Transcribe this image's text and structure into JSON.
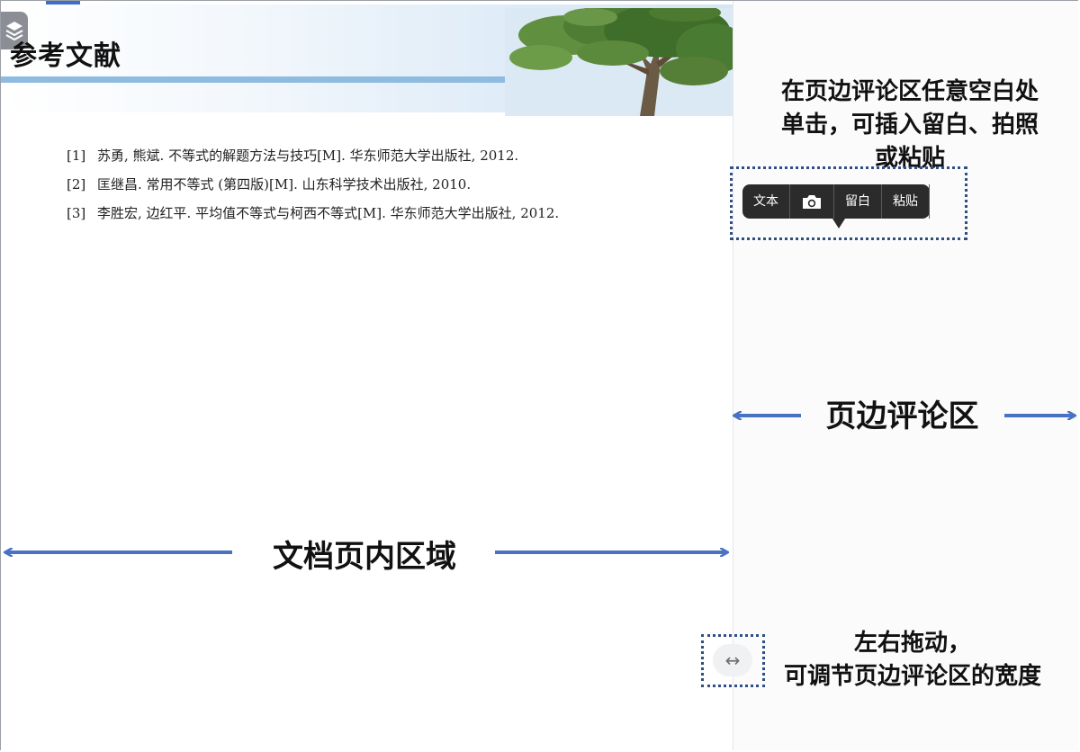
{
  "doc": {
    "title": "参考文献",
    "references": [
      {
        "num": "[1]",
        "text": "苏勇, 熊斌. 不等式的解题方法与技巧[M]. 华东师范大学出版社, 2012."
      },
      {
        "num": "[2]",
        "text": "匡继昌. 常用不等式 (第四版)[M]. 山东科学技术出版社, 2010."
      },
      {
        "num": "[3]",
        "text": "李胜宏, 边红平. 平均值不等式与柯西不等式[M]. 华东师范大学出版社, 2012."
      }
    ]
  },
  "toolbar": {
    "text_label": "文本",
    "camera_icon": "camera-icon",
    "blank_label": "留白",
    "paste_label": "粘贴"
  },
  "annotations": {
    "tip_line1": "在页边评论区任意空白处",
    "tip_line2": "单击，可插入留白、拍照",
    "tip_line3": "或粘贴",
    "margin_area": "页边评论区",
    "doc_area": "文档页内区域",
    "drag_line1": "左右拖动，",
    "drag_line2": "可调节页边评论区的宽度"
  },
  "handle": {
    "glyph": "↔"
  },
  "colors": {
    "arrow": "#4a72c2",
    "toolbar": "#2b2b2b",
    "banner_line": "#8ebbe0",
    "dotted": "#2e4f83"
  }
}
